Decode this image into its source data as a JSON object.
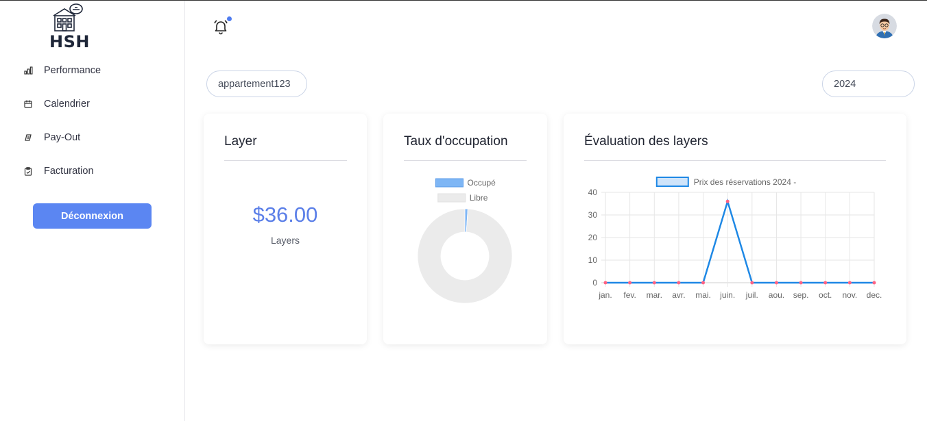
{
  "brand": {
    "logo_text": "HSH"
  },
  "sidebar": {
    "items": [
      {
        "label": "Performance",
        "icon": "bar-chart-icon"
      },
      {
        "label": "Calendrier",
        "icon": "calendar-icon"
      },
      {
        "label": "Pay-Out",
        "icon": "payout-icon"
      },
      {
        "label": "Facturation",
        "icon": "clipboard-icon"
      }
    ],
    "logout_label": "Déconnexion"
  },
  "header": {
    "notification_icon": "bell-icon",
    "has_notification": true,
    "avatar": "user-avatar"
  },
  "filters": {
    "property": "appartement123",
    "year": "2024"
  },
  "cards": {
    "layer": {
      "title": "Layer",
      "value": "$36.00",
      "label": "Layers"
    },
    "occupancy": {
      "title": "Taux d'occupation"
    },
    "evaluation": {
      "title": "Évaluation des layers"
    }
  },
  "colors": {
    "accent": "#5b86f2",
    "line": "#1e88e5",
    "occupied": "#7eb6f5",
    "free": "#ebebeb",
    "point": "#ff6384"
  },
  "chart_data": [
    {
      "type": "pie",
      "variant": "doughnut",
      "labels": [
        "Occupé",
        "Libre"
      ],
      "values": [
        1,
        99
      ],
      "legend": "top"
    },
    {
      "type": "line",
      "categories": [
        "jan.",
        "fev.",
        "mar.",
        "avr.",
        "mai.",
        "juin.",
        "juil.",
        "aou.",
        "sep.",
        "oct.",
        "nov.",
        "dec."
      ],
      "series": [
        {
          "name": "Prix des réservations 2024 -",
          "values": [
            0,
            0,
            0,
            0,
            0,
            36,
            0,
            0,
            0,
            0,
            0,
            0
          ]
        }
      ],
      "ylim": [
        0,
        40
      ],
      "yticks": [
        0,
        10,
        20,
        30,
        40
      ],
      "grid": true,
      "legend": "top"
    }
  ]
}
